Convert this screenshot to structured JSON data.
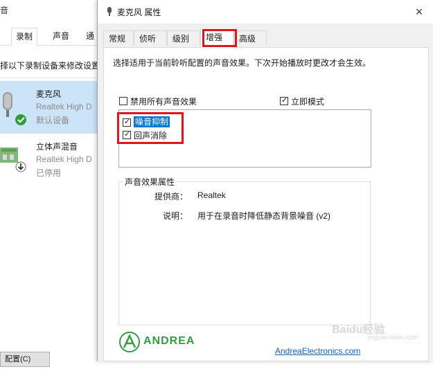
{
  "background_window": {
    "title": "音",
    "tabs": [
      "录制",
      "声音",
      "通"
    ],
    "instruction": "择以下录制设备来修改设置",
    "devices": [
      {
        "name": "麦克风",
        "driver": "Realtek High D",
        "status": "默认设备",
        "selected": true,
        "icon": "microphone-icon",
        "badge": "default-check-icon"
      },
      {
        "name": "立体声混音",
        "driver": "Realtek High D",
        "status": "已停用",
        "selected": false,
        "icon": "sound-card-icon",
        "badge": "disabled-arrow-icon"
      }
    ],
    "footer_button": "配置(C)"
  },
  "dialog": {
    "title": "麦克风 属性",
    "close_label": "×",
    "tabs": [
      "常规",
      "侦听",
      "级别",
      "增强",
      "高级"
    ],
    "active_tab": "增强",
    "description": "选择适用于当前聆听配置的声音效果。下次开始播放时更改才会生效。",
    "disable_all_label": "禁用所有声音效果",
    "disable_all_checked": false,
    "immediate_mode_label": "立即模式",
    "immediate_mode_checked": true,
    "effects": [
      {
        "label": "噪音抑制",
        "checked": true,
        "selected": true
      },
      {
        "label": "回声消除",
        "checked": true,
        "selected": false
      }
    ],
    "properties_group": "声音效果属性",
    "provider_key": "提供商：",
    "provider_value": "Realtek",
    "description_key": "说明：",
    "description_value": "用于在录音时降低静态背景噪音 (v2)",
    "logo_text": "ANDREA",
    "link_text": "AndreaElectronics.com"
  },
  "watermark": {
    "text": "Baidu经验",
    "subtext": "jingyan.baidu.com"
  },
  "colors": {
    "highlight_red": "#e0151b",
    "selection_blue": "#0078d7",
    "logo_green": "#2f9e3f",
    "link_blue": "#1a5fb4",
    "selected_row": "#cce4f7"
  }
}
